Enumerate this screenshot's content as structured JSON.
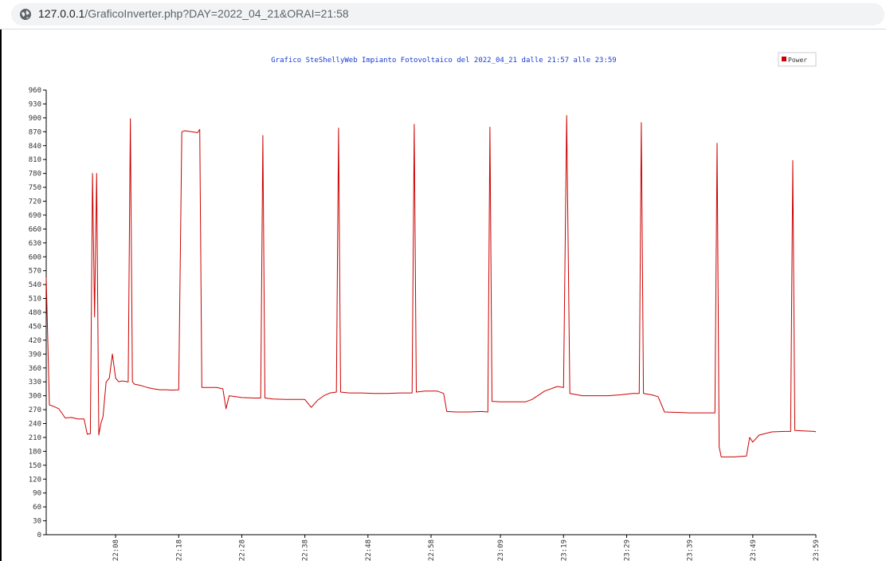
{
  "browser": {
    "url_host": "127.0.0.1",
    "url_path": "/GraficoInverter.php?DAY=2022_04_21&ORAI=21:58"
  },
  "chart_data": {
    "type": "line",
    "title": "Grafico SteShellyWeb Impianto Fotovoltaico del 2022_04_21 dalle 21:57 alle 23:59",
    "legend": {
      "position": "top-right"
    },
    "xlabel": "",
    "ylabel": "",
    "xlim": [
      "21:57",
      "23:59"
    ],
    "ylim": [
      0,
      960
    ],
    "y_ticks": [
      0,
      30,
      60,
      90,
      120,
      150,
      180,
      210,
      240,
      270,
      300,
      330,
      360,
      390,
      420,
      450,
      480,
      510,
      540,
      570,
      600,
      630,
      660,
      690,
      720,
      750,
      780,
      810,
      840,
      870,
      900,
      930,
      960
    ],
    "x_ticks": [
      "22:08",
      "22:18",
      "22:28",
      "22:38",
      "22:48",
      "22:58",
      "23:09",
      "23:19",
      "23:29",
      "23:39",
      "23:49",
      "23:59"
    ],
    "grid": false,
    "color": "#cc0000",
    "series": [
      {
        "name": "Power",
        "points": [
          [
            "21:57",
            555
          ],
          [
            "21:57",
            280
          ],
          [
            "21:58",
            278
          ],
          [
            "21:59",
            272
          ],
          [
            "22:00",
            252
          ],
          [
            "22:01",
            253
          ],
          [
            "22:02",
            250
          ],
          [
            "22:03",
            250
          ],
          [
            "22:03",
            217
          ],
          [
            "22:04",
            218
          ],
          [
            "22:04",
            780
          ],
          [
            "22:04",
            470
          ],
          [
            "22:05",
            780
          ],
          [
            "22:05",
            215
          ],
          [
            "22:05",
            240
          ],
          [
            "22:06",
            255
          ],
          [
            "22:06",
            330
          ],
          [
            "22:07",
            338
          ],
          [
            "22:07",
            390
          ],
          [
            "22:08",
            338
          ],
          [
            "22:08",
            330
          ],
          [
            "22:09",
            332
          ],
          [
            "22:10",
            330
          ],
          [
            "22:10",
            898
          ],
          [
            "22:10",
            330
          ],
          [
            "22:11",
            325
          ],
          [
            "22:12",
            322
          ],
          [
            "22:13",
            318
          ],
          [
            "22:14",
            315
          ],
          [
            "22:15",
            313
          ],
          [
            "22:16",
            313
          ],
          [
            "22:17",
            312
          ],
          [
            "22:18",
            313
          ],
          [
            "22:18",
            870
          ],
          [
            "22:19",
            872
          ],
          [
            "22:20",
            870
          ],
          [
            "22:21",
            868
          ],
          [
            "22:21",
            875
          ],
          [
            "22:21",
            318
          ],
          [
            "22:22",
            318
          ],
          [
            "22:24",
            318
          ],
          [
            "22:25",
            315
          ],
          [
            "22:25",
            272
          ],
          [
            "22:26",
            300
          ],
          [
            "22:27",
            298
          ],
          [
            "22:28",
            296
          ],
          [
            "22:30",
            295
          ],
          [
            "22:31",
            295
          ],
          [
            "22:31",
            862
          ],
          [
            "22:31",
            295
          ],
          [
            "22:33",
            293
          ],
          [
            "22:35",
            292
          ],
          [
            "22:37",
            292
          ],
          [
            "22:38",
            292
          ],
          [
            "22:39",
            275
          ],
          [
            "22:40",
            290
          ],
          [
            "22:41",
            300
          ],
          [
            "22:42",
            306
          ],
          [
            "22:43",
            308
          ],
          [
            "22:43",
            878
          ],
          [
            "22:43",
            308
          ],
          [
            "22:45",
            306
          ],
          [
            "22:47",
            306
          ],
          [
            "22:49",
            305
          ],
          [
            "22:51",
            305
          ],
          [
            "22:53",
            306
          ],
          [
            "22:55",
            306
          ],
          [
            "22:55",
            886
          ],
          [
            "22:55",
            308
          ],
          [
            "22:57",
            310
          ],
          [
            "22:59",
            310
          ],
          [
            "23:00",
            305
          ],
          [
            "23:00",
            266
          ],
          [
            "23:02",
            265
          ],
          [
            "23:04",
            265
          ],
          [
            "23:06",
            266
          ],
          [
            "23:07",
            265
          ],
          [
            "23:07",
            880
          ],
          [
            "23:07",
            288
          ],
          [
            "23:09",
            287
          ],
          [
            "23:11",
            287
          ],
          [
            "23:13",
            287
          ],
          [
            "23:14",
            292
          ],
          [
            "23:16",
            310
          ],
          [
            "23:18",
            320
          ],
          [
            "23:19",
            318
          ],
          [
            "23:19",
            905
          ],
          [
            "23:20",
            305
          ],
          [
            "23:22",
            300
          ],
          [
            "23:24",
            300
          ],
          [
            "23:26",
            300
          ],
          [
            "23:28",
            302
          ],
          [
            "23:30",
            305
          ],
          [
            "23:31",
            305
          ],
          [
            "23:31",
            890
          ],
          [
            "23:31",
            305
          ],
          [
            "23:33",
            302
          ],
          [
            "23:34",
            298
          ],
          [
            "23:35",
            265
          ],
          [
            "23:37",
            264
          ],
          [
            "23:39",
            263
          ],
          [
            "23:41",
            263
          ],
          [
            "23:43",
            263
          ],
          [
            "23:43",
            845
          ],
          [
            "23:43",
            190
          ],
          [
            "23:44",
            168
          ],
          [
            "23:46",
            168
          ],
          [
            "23:48",
            170
          ],
          [
            "23:48",
            210
          ],
          [
            "23:49",
            200
          ],
          [
            "23:50",
            215
          ],
          [
            "23:52",
            222
          ],
          [
            "23:54",
            223
          ],
          [
            "23:55",
            223
          ],
          [
            "23:55",
            808
          ],
          [
            "23:55",
            225
          ],
          [
            "23:57",
            224
          ],
          [
            "23:59",
            223
          ],
          [
            "23:59",
            222
          ]
        ]
      }
    ]
  }
}
